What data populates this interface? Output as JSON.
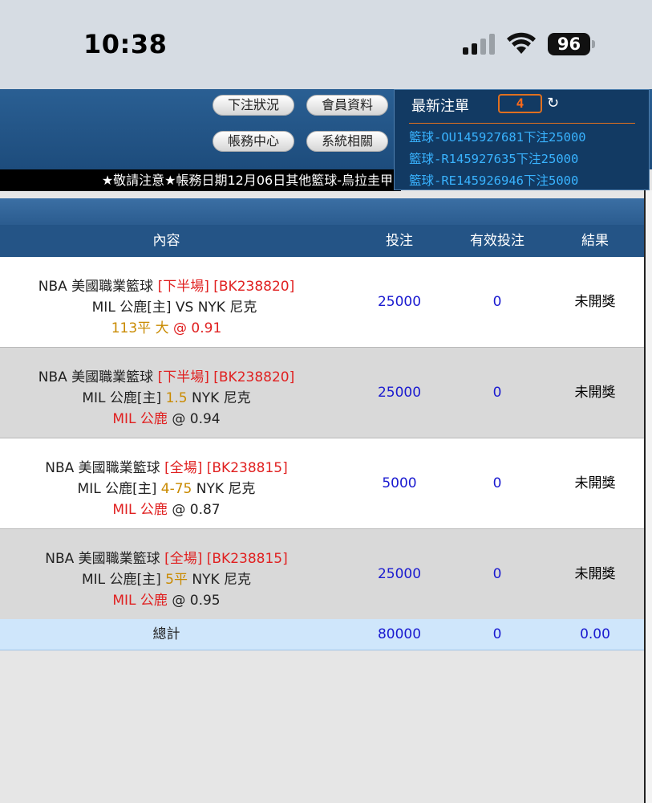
{
  "status_bar": {
    "time": "10:38",
    "battery": "96"
  },
  "header": {
    "buttons": {
      "bet_status": "下注狀況",
      "member_info": "會員資料",
      "account_center": "帳務中心",
      "system": "系統相關"
    },
    "ticker": "★敬請注意★帳務日期12月06日其他籃球-烏拉圭甲"
  },
  "latest": {
    "title": "最新注單",
    "count": "4",
    "refresh_icon": "refresh-icon",
    "items": [
      "籃球-OU145927681下注25000",
      "籃球-R145927635下注25000",
      "籃球-RE145926946下注5000"
    ]
  },
  "table": {
    "headers": {
      "content": "內容",
      "bet": "投注",
      "valid": "有效投注",
      "result": "結果"
    },
    "rows": [
      {
        "league": "NBA 美國職業籃球",
        "period": "[下半場]",
        "code": "[BK238820]",
        "home": "MIL 公鹿[主]",
        "line": "VS",
        "away": "NYK 尼克",
        "pick": "113平 大",
        "odds": "@ 0.91",
        "bet": "25000",
        "valid": "0",
        "result": "未開獎"
      },
      {
        "league": "NBA 美國職業籃球",
        "period": "[下半場]",
        "code": "[BK238820]",
        "home": "MIL 公鹿[主]",
        "line": "1.5",
        "away": "NYK 尼克",
        "pick": "MIL 公鹿",
        "odds": "@ 0.94",
        "bet": "25000",
        "valid": "0",
        "result": "未開獎"
      },
      {
        "league": "NBA 美國職業籃球",
        "period": "[全場]",
        "code": "[BK238815]",
        "home": "MIL 公鹿[主]",
        "line": "4-75",
        "away": "NYK 尼克",
        "pick": "MIL 公鹿",
        "odds": "@ 0.87",
        "bet": "5000",
        "valid": "0",
        "result": "未開獎"
      },
      {
        "league": "NBA 美國職業籃球",
        "period": "[全場]",
        "code": "[BK238815]",
        "home": "MIL 公鹿[主]",
        "line": "5平",
        "away": "NYK 尼克",
        "pick": "MIL 公鹿",
        "odds": "@ 0.95",
        "bet": "25000",
        "valid": "0",
        "result": "未開獎"
      }
    ],
    "total": {
      "label": "總計",
      "bet": "80000",
      "valid": "0",
      "result": "0.00"
    }
  }
}
